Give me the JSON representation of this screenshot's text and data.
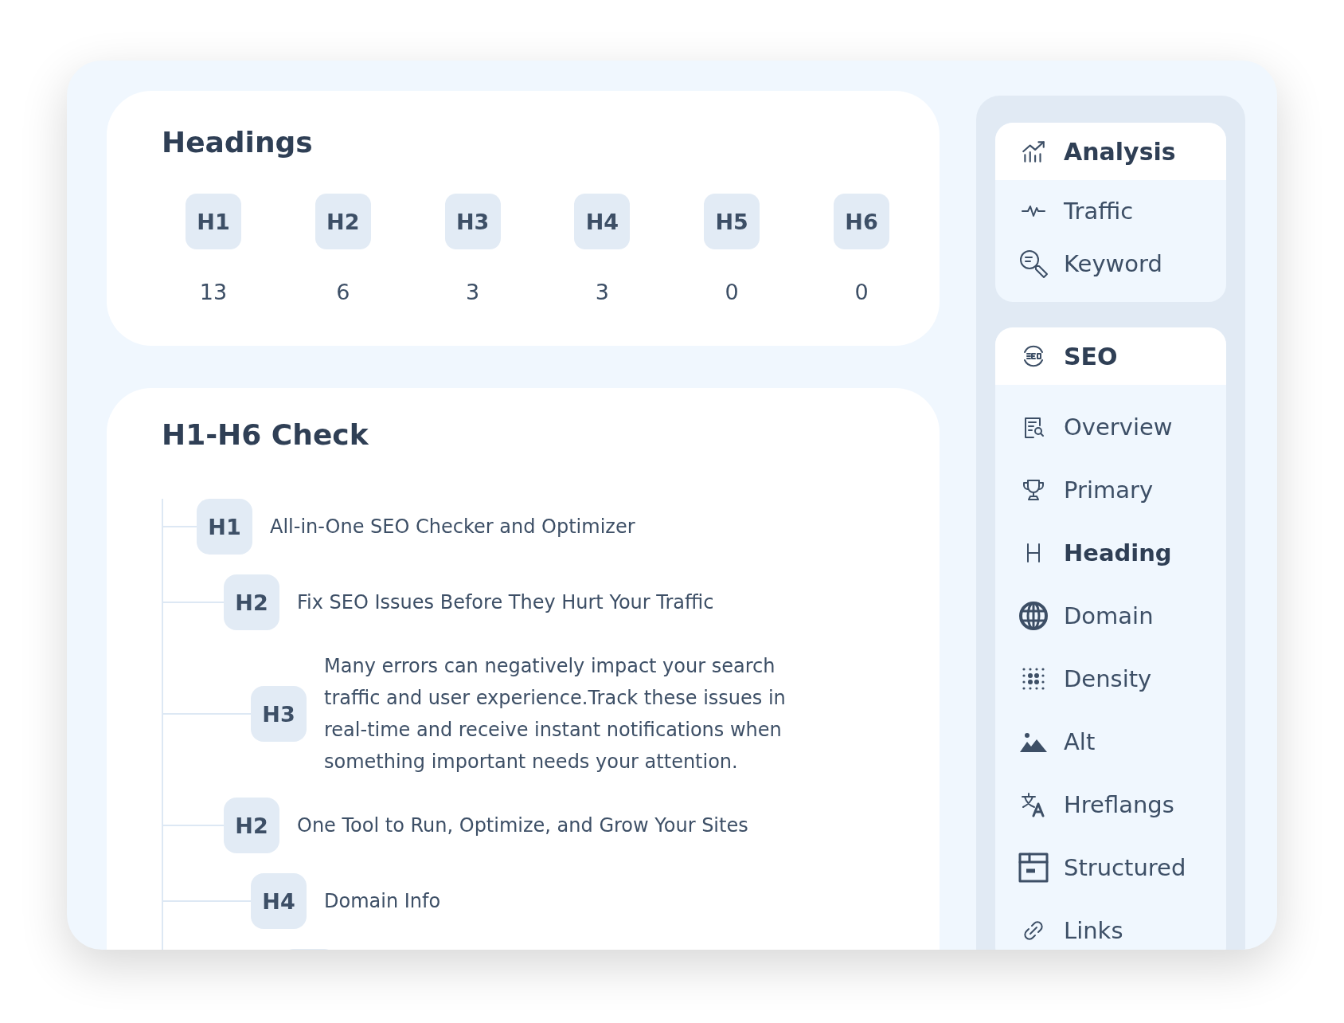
{
  "headings_card": {
    "title": "Headings",
    "levels": [
      {
        "label": "H1",
        "count": "13"
      },
      {
        "label": "H2",
        "count": "6"
      },
      {
        "label": "H3",
        "count": "3"
      },
      {
        "label": "H4",
        "count": "3"
      },
      {
        "label": "H5",
        "count": "0"
      },
      {
        "label": "H6",
        "count": "0"
      }
    ]
  },
  "check_card": {
    "title": "H1-H6 Check",
    "tree": [
      {
        "tag": "H1",
        "text": "All-in-One SEO Checker and Optimizer",
        "children": [
          {
            "tag": "H2",
            "text": "Fix SEO Issues Before They Hurt Your Traffic",
            "children": [
              {
                "tag": "H3",
                "text": "Many errors can negatively impact your search traffic and user experience.Track these issues in real-time and receive instant notifications when something important needs your attention."
              }
            ]
          },
          {
            "tag": "H2",
            "text": "One Tool to Run, Optimize, and Grow Your Sites",
            "children": [
              {
                "tag": "H4",
                "text": "Domain Info"
              }
            ]
          }
        ]
      }
    ]
  },
  "sidebar": {
    "groups": [
      {
        "title": "Analysis",
        "items": [
          {
            "label": "Traffic",
            "selected": false
          },
          {
            "label": "Keyword",
            "selected": false
          }
        ]
      },
      {
        "title": "SEO",
        "items": [
          {
            "label": "Overview",
            "selected": false
          },
          {
            "label": "Primary",
            "selected": false
          },
          {
            "label": "Heading",
            "selected": true
          },
          {
            "label": "Domain",
            "selected": false
          },
          {
            "label": "Density",
            "selected": false
          },
          {
            "label": "Alt",
            "selected": false
          },
          {
            "label": "Hreflangs",
            "selected": false
          },
          {
            "label": "Structured",
            "selected": false
          },
          {
            "label": "Links",
            "selected": false
          }
        ]
      }
    ]
  }
}
